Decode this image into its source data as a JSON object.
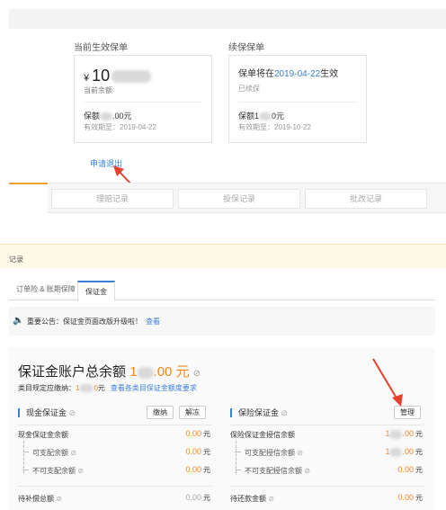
{
  "top": {
    "current_label": "当前生效保单",
    "renew_label": "续保保单",
    "current_card": {
      "currency": "¥",
      "amount_visible": "10",
      "balance_label": "当前余额",
      "coverage_prefix": "保额",
      "coverage_suffix": ".00元",
      "valid_until": "有效期至：2019-04-22"
    },
    "renew_card": {
      "title_prefix": "保单将在",
      "title_date": "2019-04-22",
      "title_suffix": "生效",
      "status": "已续保",
      "coverage_prefix": "保额1",
      "coverage_suffix": "0元",
      "valid_until": "有效期至：2019-10-22"
    },
    "apply_exit": "申请退出"
  },
  "tabs": [
    "理赔记录",
    "投保记录",
    "批改记录"
  ],
  "notice_strip_text": "记录",
  "section2": {
    "tabs": [
      "订单险 & 账期保障",
      "保证金"
    ],
    "announcement": {
      "text": "重要公告：保证金页面改版升级啦！",
      "link": "查看"
    },
    "total": {
      "label": "保证金账户总余额",
      "amount_prefix": "1",
      "amount_suffix": ".00",
      "unit": "元",
      "help": "⊘"
    },
    "sub_note": {
      "prefix": "类目规定应缴纳：",
      "amount_prefix": "1",
      "amount_suffix": "0",
      "unit": "元",
      "link": "查看各类目保证金额度要求"
    },
    "cash": {
      "title": "现金保证金",
      "btn_pay": "缴纳",
      "btn_free": "解冻",
      "rows": [
        {
          "label": "现金保证金余额",
          "value": "0.00",
          "unit": "元"
        },
        {
          "label": "可支配余额",
          "value": "0.00",
          "unit": "元"
        },
        {
          "label": "不可支配余额",
          "value": "0.00",
          "unit": "元"
        }
      ],
      "bottom": {
        "label": "待补偿总额",
        "value": "0.00",
        "unit": "元"
      }
    },
    "insurance": {
      "title": "保险保证金",
      "btn_manage": "管理",
      "rows": [
        {
          "label": "保险保证金授信余额",
          "value_prefix": "1",
          "value_suffix": ".00",
          "unit": "元"
        },
        {
          "label": "可支配授信余额",
          "value_prefix": "1",
          "value_suffix": ".00",
          "unit": "元"
        },
        {
          "label": "不可支配授信余额",
          "value": "0.00",
          "unit": "元"
        }
      ],
      "bottom": {
        "label": "待还款金额",
        "value": "0.00",
        "unit": "元"
      }
    }
  },
  "colors": {
    "accent": "#3a7fd6",
    "amount": "#f0861f",
    "arrow": "#e8402e",
    "tab_active": "#f0a030"
  }
}
